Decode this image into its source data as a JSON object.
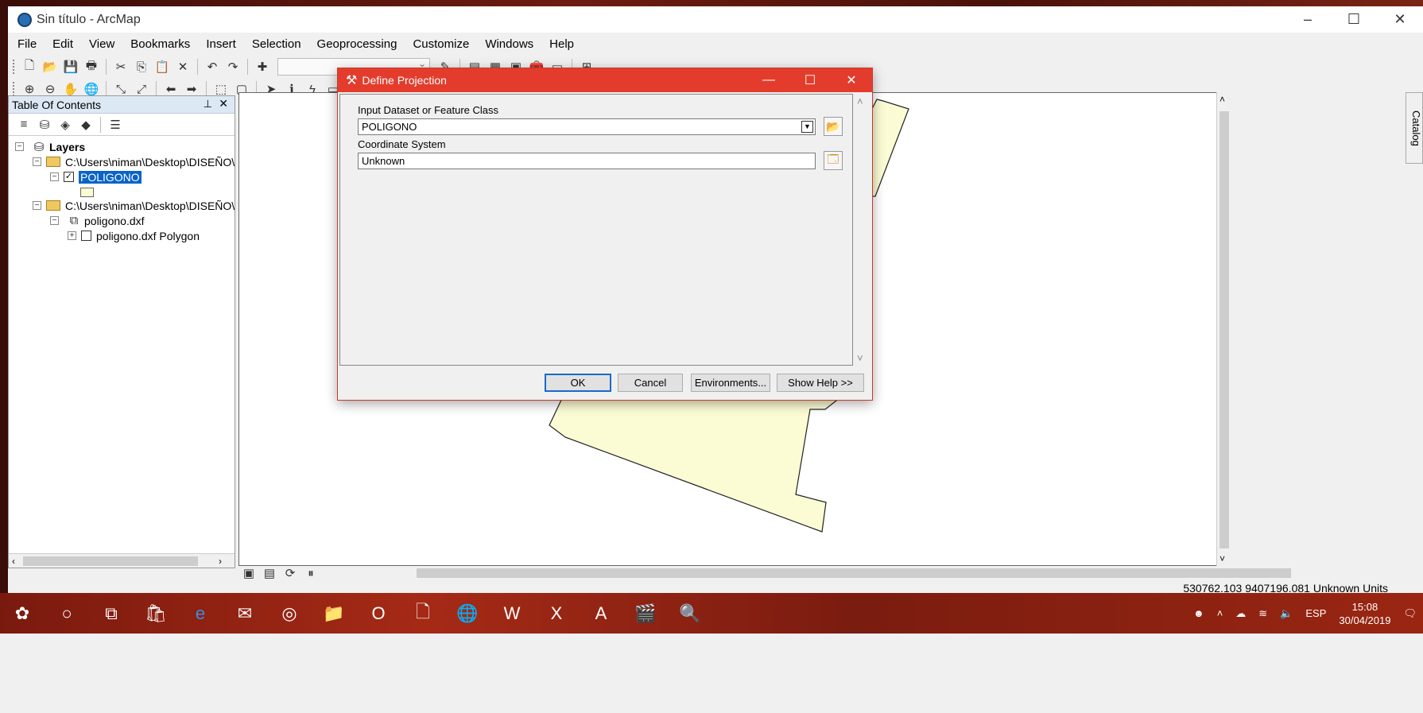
{
  "window": {
    "title": "Sin título - ArcMap"
  },
  "menu": [
    "File",
    "Edit",
    "View",
    "Bookmarks",
    "Insert",
    "Selection",
    "Geoprocessing",
    "Customize",
    "Windows",
    "Help"
  ],
  "toc": {
    "title": "Table Of Contents",
    "layers_label": "Layers",
    "folder1": "C:\\Users\\niman\\Desktop\\DISEÑO\\",
    "layer1": "POLIGONO",
    "folder2": "C:\\Users\\niman\\Desktop\\DISEÑO\\",
    "dxf": "poligono.dxf",
    "dxf_polygon": "poligono.dxf Polygon"
  },
  "catalog_label": "Catalog",
  "status": {
    "coords": "530762.103  9407196.081 Unknown Units"
  },
  "dialog": {
    "title": "Define Projection",
    "input_label": "Input Dataset or Feature Class",
    "input_value": "POLIGONO",
    "cs_label": "Coordinate System",
    "cs_value": "Unknown",
    "ok": "OK",
    "cancel": "Cancel",
    "env": "Environments...",
    "help": "Show Help >>"
  },
  "tray": {
    "lang": "ESP",
    "time": "15:08",
    "date": "30/04/2019"
  },
  "polygon_fill": "#fbfbd4",
  "accent": "#e43c2c"
}
